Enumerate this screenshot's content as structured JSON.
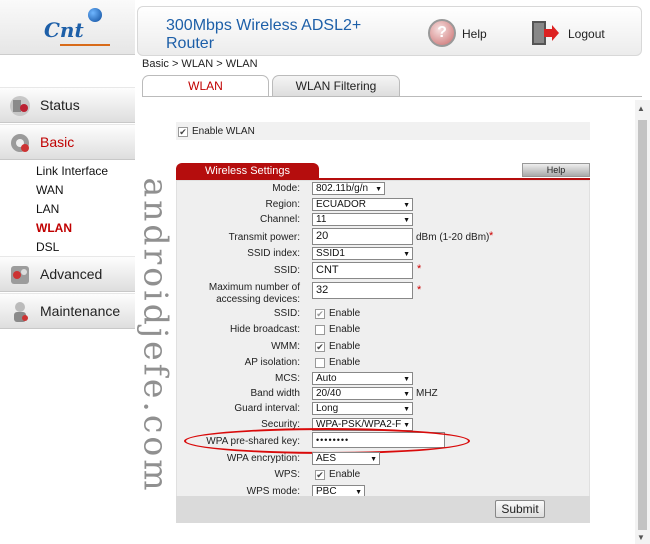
{
  "header": {
    "title": "300Mbps Wireless ADSL2+ Router",
    "help_label": "Help",
    "logout_label": "Logout"
  },
  "breadcrumb": "Basic > WLAN > WLAN",
  "tabs": [
    "WLAN",
    "WLAN Filtering"
  ],
  "sidebar": {
    "logo_text": "Cnt",
    "items": [
      {
        "label": "Status"
      },
      {
        "label": "Basic"
      },
      {
        "label": "Advanced"
      },
      {
        "label": "Maintenance"
      }
    ],
    "sub_items": [
      "Link Interface",
      "WAN",
      "LAN",
      "WLAN",
      "DSL"
    ]
  },
  "enable_wlan_label": "Enable WLAN",
  "section": {
    "title": "Wireless Settings",
    "help_label": "Help"
  },
  "form": {
    "mode": {
      "label": "Mode:",
      "value": "802.11b/g/n"
    },
    "region": {
      "label": "Region:",
      "value": "ECUADOR"
    },
    "channel": {
      "label": "Channel:",
      "value": "11"
    },
    "transmit_power": {
      "label": "Transmit power:",
      "value": "20",
      "unit": "dBm (1-20 dBm)"
    },
    "ssid_index": {
      "label": "SSID index:",
      "value": "SSID1"
    },
    "ssid": {
      "label": "SSID:",
      "value": "CNT"
    },
    "max_devices": {
      "label": "Maximum number of accessing devices:",
      "value": "32"
    },
    "ssid_enable": {
      "label": "SSID:",
      "text": "Enable"
    },
    "hide_broadcast": {
      "label": "Hide broadcast:",
      "text": "Enable"
    },
    "wmm": {
      "label": "WMM:",
      "text": "Enable"
    },
    "ap_isolation": {
      "label": "AP isolation:",
      "text": "Enable"
    },
    "mcs": {
      "label": "MCS:",
      "value": "Auto"
    },
    "band_width": {
      "label": "Band width",
      "value": "20/40",
      "unit": "MHZ"
    },
    "guard_interval": {
      "label": "Guard interval:",
      "value": "Long"
    },
    "security": {
      "label": "Security:",
      "value": "WPA-PSK/WPA2-F"
    },
    "wpa_key": {
      "label": "WPA pre-shared key:",
      "value": "••••••••"
    },
    "wpa_encryption": {
      "label": "WPA encryption:",
      "value": "AES"
    },
    "wps": {
      "label": "WPS:",
      "text": "Enable"
    },
    "wps_mode": {
      "label": "WPS mode:",
      "value": "PBC"
    },
    "required_mark": "*"
  },
  "submit_label": "Submit",
  "watermark": "androidjefe.com",
  "colors": {
    "accent_red": "#b50d0d",
    "brand_blue": "#1d5fa8"
  }
}
